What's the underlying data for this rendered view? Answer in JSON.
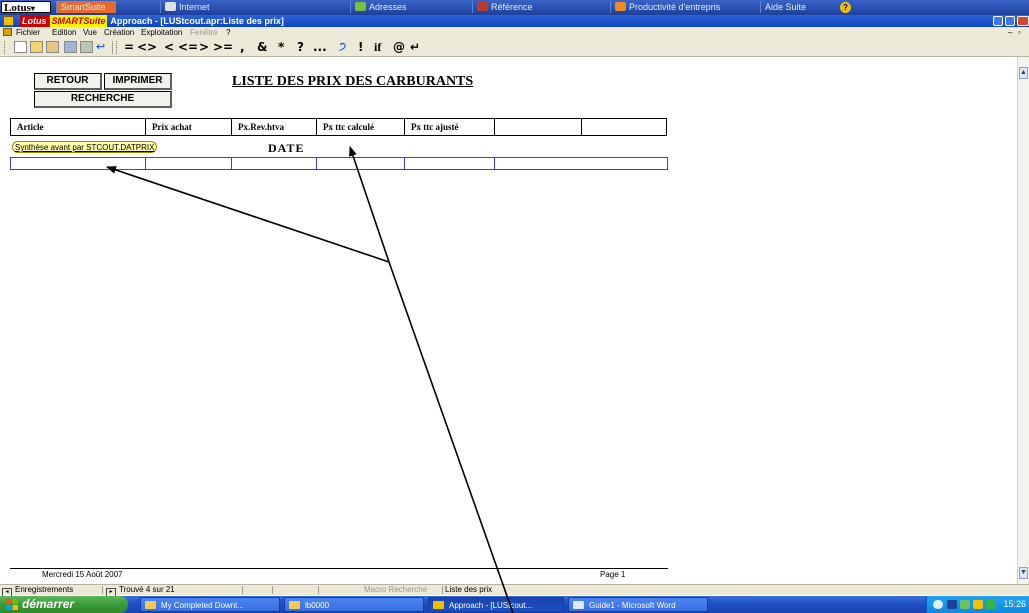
{
  "suite_bar": {
    "logo": "Lotus",
    "items": [
      "SmartSuite",
      "Internet",
      "Adresses",
      "Référence",
      "Productivité d'entrepris",
      "Aide Suite"
    ]
  },
  "window": {
    "badge_left": "Lotus",
    "badge_right": "SMARTSuite",
    "title": "Approach - [LUStcout.apr:Liste des prix]"
  },
  "menu": {
    "items": [
      "Fichier",
      "Edition",
      "Vue",
      "Création",
      "Exploitation",
      "Fenêtre",
      "?"
    ]
  },
  "toolbar": {
    "operators": [
      "=",
      "<>",
      "<",
      "<=",
      ">",
      ">=",
      ",",
      "&",
      "*",
      "?",
      "...",
      "!",
      "if",
      "@"
    ]
  },
  "form": {
    "buttons": {
      "retour": "RETOUR",
      "imprimer": "IMPRIMER",
      "recherche": "RECHERCHE"
    },
    "title": "LISTE DES PRIX DES CARBURANTS",
    "columns": [
      "Article",
      "Prix achat",
      "Px.Rev.htva",
      "Px ttc calculé",
      "Px ttc ajusté",
      "",
      ""
    ],
    "summary_label": "Synthèse avant par STCOUT.DATPRIX",
    "date_label": "DATE",
    "footer_date": "Mercredi 15 Août 2007",
    "footer_page": "Page 1"
  },
  "status_bar": {
    "records": "Enregistrements",
    "found": "Trouvé 4 sur 21",
    "macro": "Macro Recherche",
    "view": "Liste des prix"
  },
  "taskbar": {
    "start": "démarrer",
    "tasks": [
      "My Completed Downl...",
      "lb0000",
      "Approach - [LUStcout...",
      "Guide1 - Microsoft Word"
    ],
    "clock": "15:26"
  },
  "colors": {
    "taskbar_blue": "#2a5fd0",
    "start_green": "#3b9b38",
    "summary_yellow": "#fffca8",
    "title_blue": "#0b44c2"
  }
}
